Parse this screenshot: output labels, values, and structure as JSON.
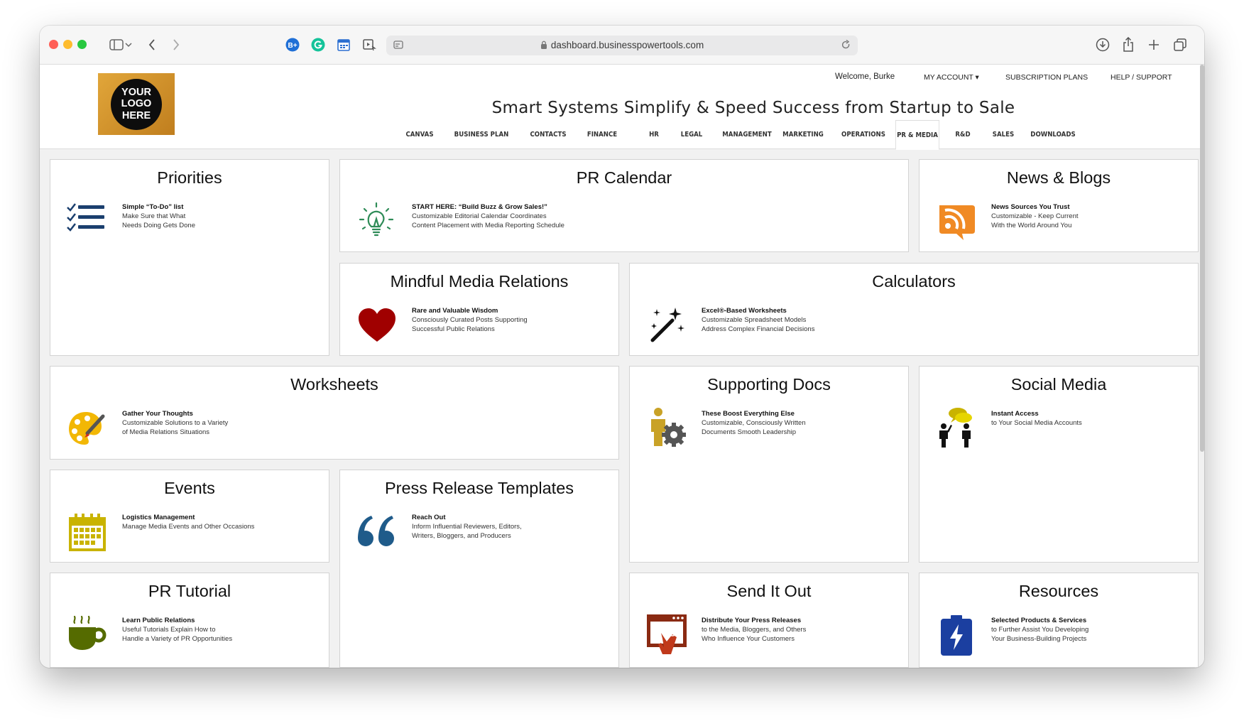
{
  "browser": {
    "url": "dashboard.businesspowertools.com"
  },
  "header": {
    "logo_lines": [
      "YOUR",
      "LOGO",
      "HERE"
    ],
    "welcome": "Welcome, Burke",
    "my_account": "MY ACCOUNT ▾",
    "subscription": "SUBSCRIPTION PLANS",
    "help": "HELP / SUPPORT",
    "tagline": "Smart Systems Simplify & Speed Success from Startup to Sale",
    "tabs": [
      "CANVAS",
      "BUSINESS PLAN",
      "CONTACTS",
      "FINANCE",
      "HR",
      "LEGAL",
      "MANAGEMENT",
      "MARKETING",
      "OPERATIONS",
      "PR & MEDIA",
      "R&D",
      "SALES",
      "DOWNLOADS"
    ],
    "active_tab": "PR & MEDIA"
  },
  "cards": [
    {
      "title": "Priorities",
      "icon": "checklist-icon",
      "lines": [
        "Simple “To-Do” list",
        "Make Sure that What",
        "Needs Doing Gets Done"
      ]
    },
    {
      "title": "PR Calendar",
      "icon": "lightbulb-icon",
      "lines": [
        "START HERE: “Build Buzz & Grow Sales!”",
        "Customizable Editorial Calendar Coordinates",
        "Content Placement with Media Reporting Schedule"
      ]
    },
    {
      "title": "News & Blogs",
      "icon": "rss-icon",
      "lines": [
        "News Sources You Trust",
        "Customizable - Keep Current",
        "With the World Around You"
      ]
    },
    {
      "title": "Mindful Media Relations",
      "icon": "heart-icon",
      "lines": [
        "Rare and Valuable Wisdom",
        "Consciously Curated Posts Supporting",
        "Successful Public Relations"
      ]
    },
    {
      "title": "Calculators",
      "icon": "magic-wand-icon",
      "lines": [
        "Excel®-Based Worksheets",
        "Customizable Spreadsheet Models",
        "Address Complex Financial Decisions"
      ]
    },
    {
      "title": "Worksheets",
      "icon": "palette-icon",
      "lines": [
        "Gather Your Thoughts",
        "Customizable Solutions to a Variety",
        "of Media Relations Situations"
      ]
    },
    {
      "title": "Supporting Docs",
      "icon": "gear-person-icon",
      "lines": [
        "These Boost Everything Else",
        "Customizable, Consciously Written",
        "Documents Smooth Leadership"
      ]
    },
    {
      "title": "Social Media",
      "icon": "people-chat-icon",
      "lines": [
        "Instant Access",
        "to Your Social Media Accounts"
      ]
    },
    {
      "title": "Events",
      "icon": "calendar-icon",
      "lines": [
        "Logistics Management",
        "Manage Media Events and Other Occasions"
      ]
    },
    {
      "title": "Press Release Templates",
      "icon": "quote-icon",
      "lines": [
        "Reach Out",
        "Inform Influential Reviewers, Editors,",
        "Writers, Bloggers, and Producers"
      ]
    },
    {
      "title": "PR Tutorial",
      "icon": "coffee-cup-icon",
      "lines": [
        "Learn Public Relations",
        "Useful Tutorials Explain How to",
        "Handle a Variety of PR Opportunities"
      ]
    },
    {
      "title": "Send It Out",
      "icon": "click-window-icon",
      "lines": [
        "Distribute Your Press Releases",
        "to the Media, Bloggers, and Others",
        "Who Influence Your Customers"
      ]
    },
    {
      "title": "Resources",
      "icon": "battery-icon",
      "lines": [
        "Selected Products & Services",
        "to Further Assist You Developing",
        "Your Business-Building Projects"
      ]
    }
  ],
  "colors": {
    "navy": "#1b3f6e",
    "orange": "#f08a24",
    "green": "#2e8b57",
    "dark_red": "#a00000",
    "brown": "#8a2a12",
    "olive": "#556b00",
    "yellow": "#c9b300",
    "blue_quote": "#1f5b8a",
    "battery_blue": "#1b3fa0"
  }
}
